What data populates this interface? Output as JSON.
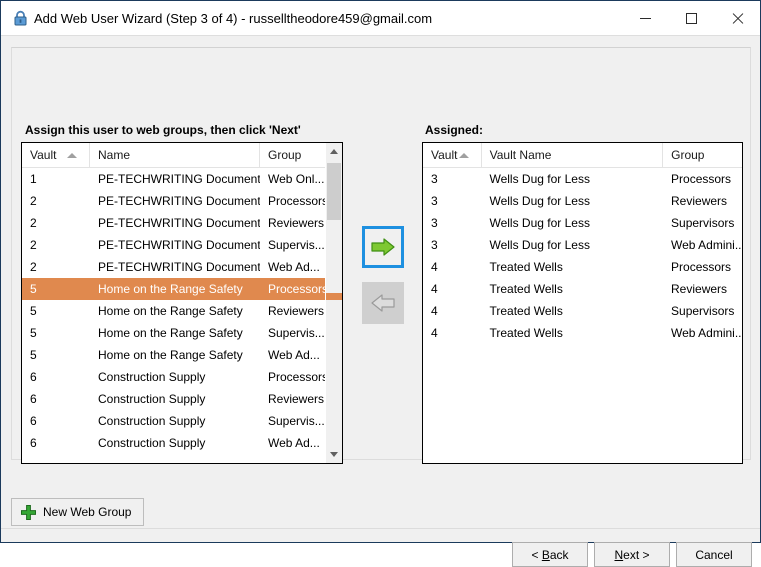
{
  "window": {
    "title": "Add Web User Wizard (Step 3 of 4) - russelltheodore459@gmail.com",
    "icon": "lock-icon",
    "minimize_label": "",
    "maximize_label": "",
    "close_label": ""
  },
  "left_panel": {
    "label": "Assign this user to web groups, then click 'Next'",
    "columns": [
      "Vault",
      "Name",
      "Group"
    ],
    "sorted_column": "Vault",
    "sort_direction": "ascending",
    "selected_row_index": 5,
    "rows": [
      {
        "vault": "1",
        "name": "PE-TECHWRITING Documents",
        "group": "Web Onl..."
      },
      {
        "vault": "2",
        "name": "PE-TECHWRITING Documents ...",
        "group": "Processors"
      },
      {
        "vault": "2",
        "name": "PE-TECHWRITING Documents ...",
        "group": "Reviewers"
      },
      {
        "vault": "2",
        "name": "PE-TECHWRITING Documents ...",
        "group": "Supervis..."
      },
      {
        "vault": "2",
        "name": "PE-TECHWRITING Documents ...",
        "group": "Web Ad..."
      },
      {
        "vault": "5",
        "name": "Home on the Range Safety",
        "group": "Processors"
      },
      {
        "vault": "5",
        "name": "Home on the Range Safety",
        "group": "Reviewers"
      },
      {
        "vault": "5",
        "name": "Home on the Range Safety",
        "group": "Supervis..."
      },
      {
        "vault": "5",
        "name": "Home on the Range Safety",
        "group": "Web Ad..."
      },
      {
        "vault": "6",
        "name": "Construction Supply",
        "group": "Processors"
      },
      {
        "vault": "6",
        "name": "Construction Supply",
        "group": "Reviewers"
      },
      {
        "vault": "6",
        "name": "Construction Supply",
        "group": "Supervis..."
      },
      {
        "vault": "6",
        "name": "Construction Supply",
        "group": "Web Ad..."
      }
    ]
  },
  "right_panel": {
    "label": "Assigned:",
    "columns": [
      "Vault",
      "Vault Name",
      "Group"
    ],
    "sorted_column": "Vault",
    "sort_direction": "ascending",
    "rows": [
      {
        "vault": "3",
        "name": "Wells Dug for Less",
        "group": "Processors"
      },
      {
        "vault": "3",
        "name": "Wells Dug for Less",
        "group": "Reviewers"
      },
      {
        "vault": "3",
        "name": "Wells Dug for Less",
        "group": "Supervisors"
      },
      {
        "vault": "3",
        "name": "Wells Dug for Less",
        "group": "Web Admini..."
      },
      {
        "vault": "4",
        "name": "Treated Wells",
        "group": "Processors"
      },
      {
        "vault": "4",
        "name": "Treated Wells",
        "group": "Reviewers"
      },
      {
        "vault": "4",
        "name": "Treated Wells",
        "group": "Supervisors"
      },
      {
        "vault": "4",
        "name": "Treated Wells",
        "group": "Web Admini..."
      }
    ]
  },
  "transfer": {
    "add_icon": "arrow-right-icon",
    "remove_icon": "arrow-left-icon",
    "add_enabled": true,
    "remove_enabled": false
  },
  "toolbar": {
    "new_group_label": "New Web Group",
    "new_group_icon": "plus-icon"
  },
  "footer": {
    "back_label": "< Back",
    "back_accel": "B",
    "next_label": "Next >",
    "next_accel": "N",
    "cancel_label": "Cancel"
  },
  "colors": {
    "selection": "#e0894e",
    "focus_border": "#1e90e0",
    "arrow_green": "#7ec832",
    "plus_green": "#35a735",
    "window_border": "#1b3a5c"
  }
}
